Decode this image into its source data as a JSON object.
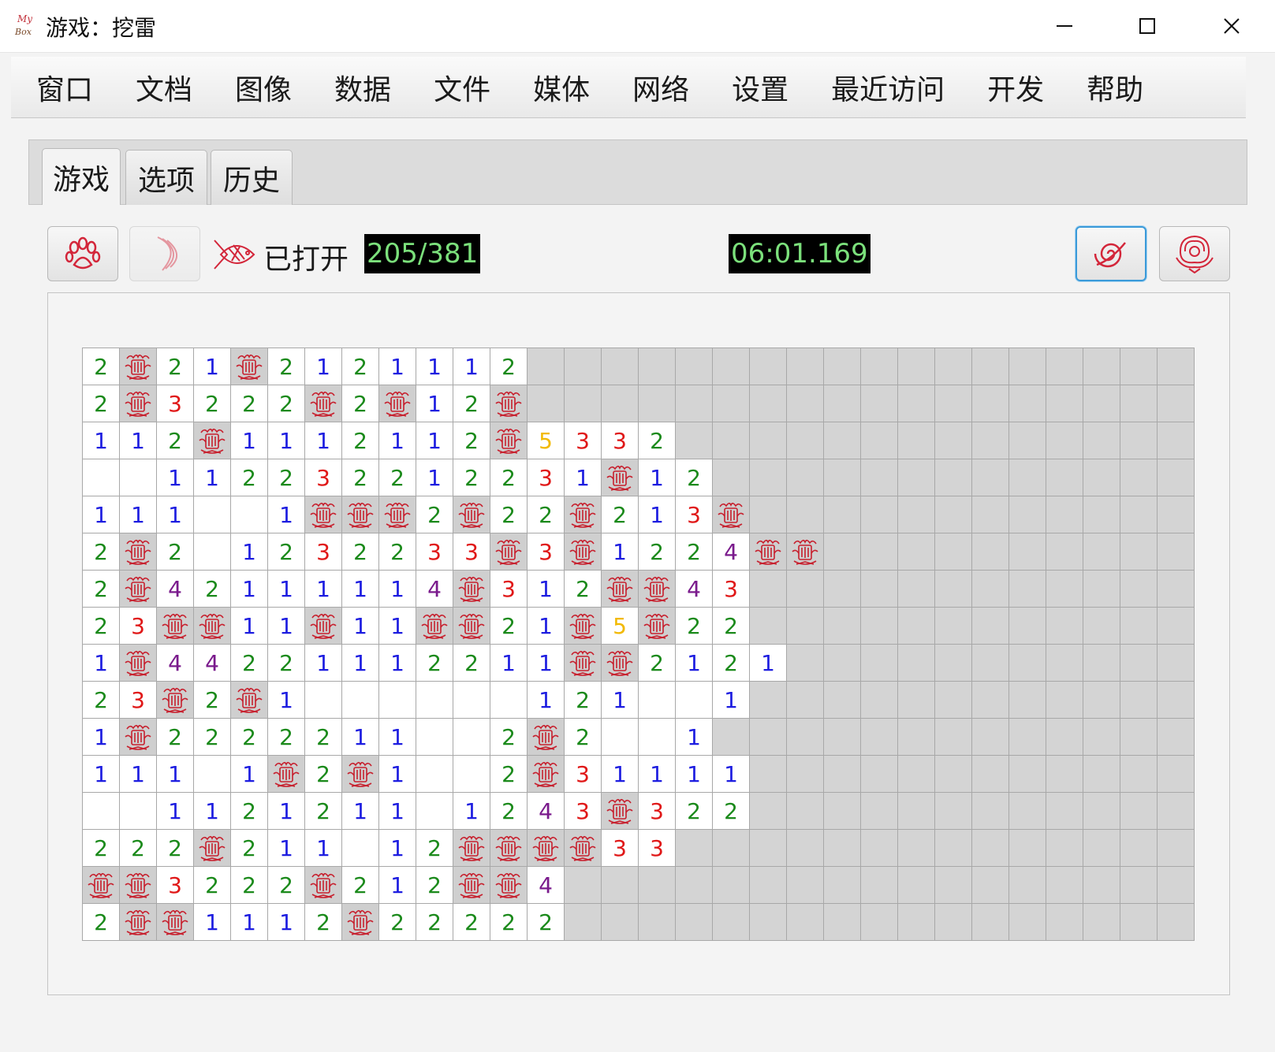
{
  "window": {
    "logo_text": "My Box",
    "title": "游戏：挖雷"
  },
  "menu": [
    "窗口",
    "文档",
    "图像",
    "数据",
    "文件",
    "媒体",
    "网络",
    "设置",
    "最近访问",
    "开发",
    "帮助"
  ],
  "tabs": [
    {
      "label": "游戏",
      "active": true
    },
    {
      "label": "选项",
      "active": false
    },
    {
      "label": "历史",
      "active": false
    }
  ],
  "toolbar": {
    "paw_icon": "paw-icon",
    "moon_icon": "crescent-icon",
    "opened_icon": "fish-icon",
    "opened_label": "已打开",
    "opened_count": "205/381",
    "timer": "06:01.169",
    "spiral_icon": "spiral-icon",
    "flower_icon": "peony-icon",
    "accent_color": "#d3263a",
    "counter_text_color": "#7be07b"
  },
  "board": {
    "cols": 30,
    "rows": 16,
    "legend": "digits = neighbor count, 0 = opened blank, M = mine icon, . = unopened",
    "cells": [
      "2M21M2121112..................",
      "2M3222M2M12M..................",
      "112M1112112M5332..............",
      "00112232212231M12.............",
      "1110 1MMM2M22M213M............",
      "2M201232233M3M1224MM..........",
      "2M42111114M312MM43............",
      "23MM11M11MM21M5M22............",
      "1M44221112211MM2121...........",
      "23M2M1000000121001............",
      "1M2222211002M2001.............",
      "111 1M2M1002M31111............",
      "00112121101243M322............",
      "222M211012MMMM33..............",
      "MM3222M212MM4.................",
      "2MM1112M22222................."
    ]
  }
}
